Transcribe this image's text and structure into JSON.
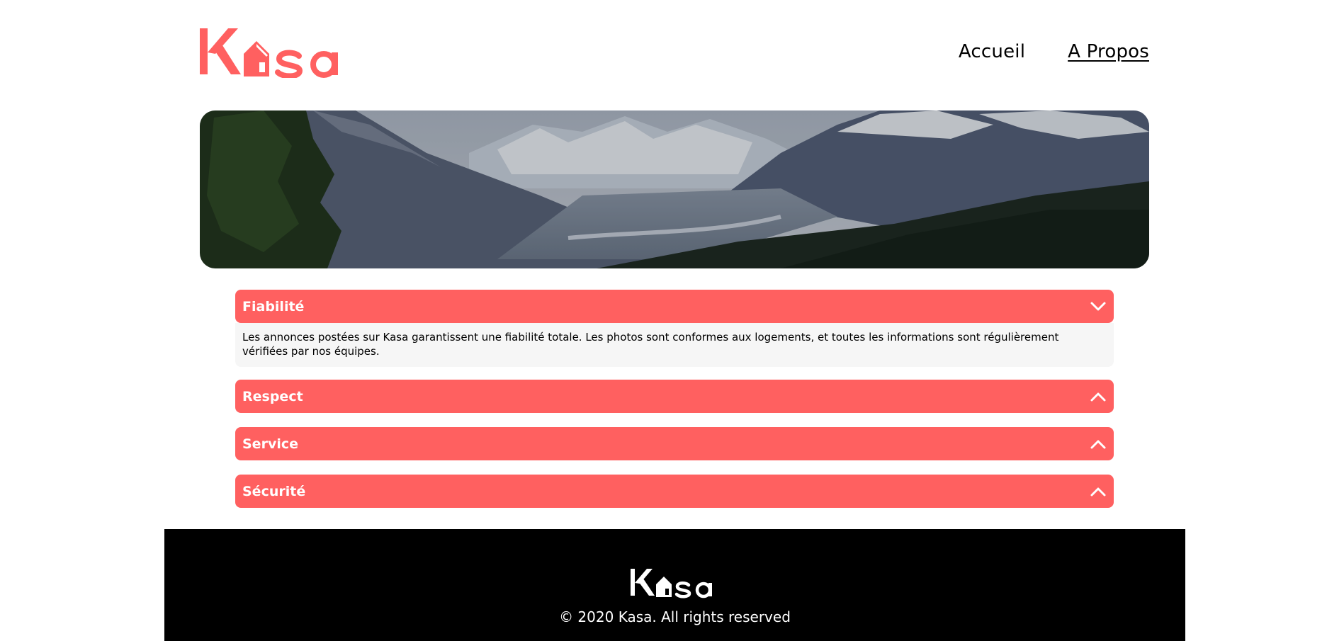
{
  "brand": {
    "name": "Kasa",
    "color": "#FF6060"
  },
  "nav": {
    "items": [
      {
        "label": "Accueil",
        "active": false
      },
      {
        "label": "A Propos",
        "active": true
      }
    ]
  },
  "banner": {
    "image": "mountain-valley-landscape"
  },
  "accordions": [
    {
      "title": "Fiabilité",
      "expanded": true,
      "chevron": "chevron-down-icon",
      "content": "Les annonces postées sur Kasa garantissent une fiabilité totale. Les photos sont conformes aux logements, et toutes les informations sont régulièrement vérifiées par nos équipes."
    },
    {
      "title": "Respect",
      "expanded": false,
      "chevron": "chevron-up-icon"
    },
    {
      "title": "Service",
      "expanded": false,
      "chevron": "chevron-up-icon"
    },
    {
      "title": "Sécurité",
      "expanded": false,
      "chevron": "chevron-up-icon"
    }
  ],
  "footer": {
    "copyright": "© 2020 Kasa. All rights reserved"
  }
}
